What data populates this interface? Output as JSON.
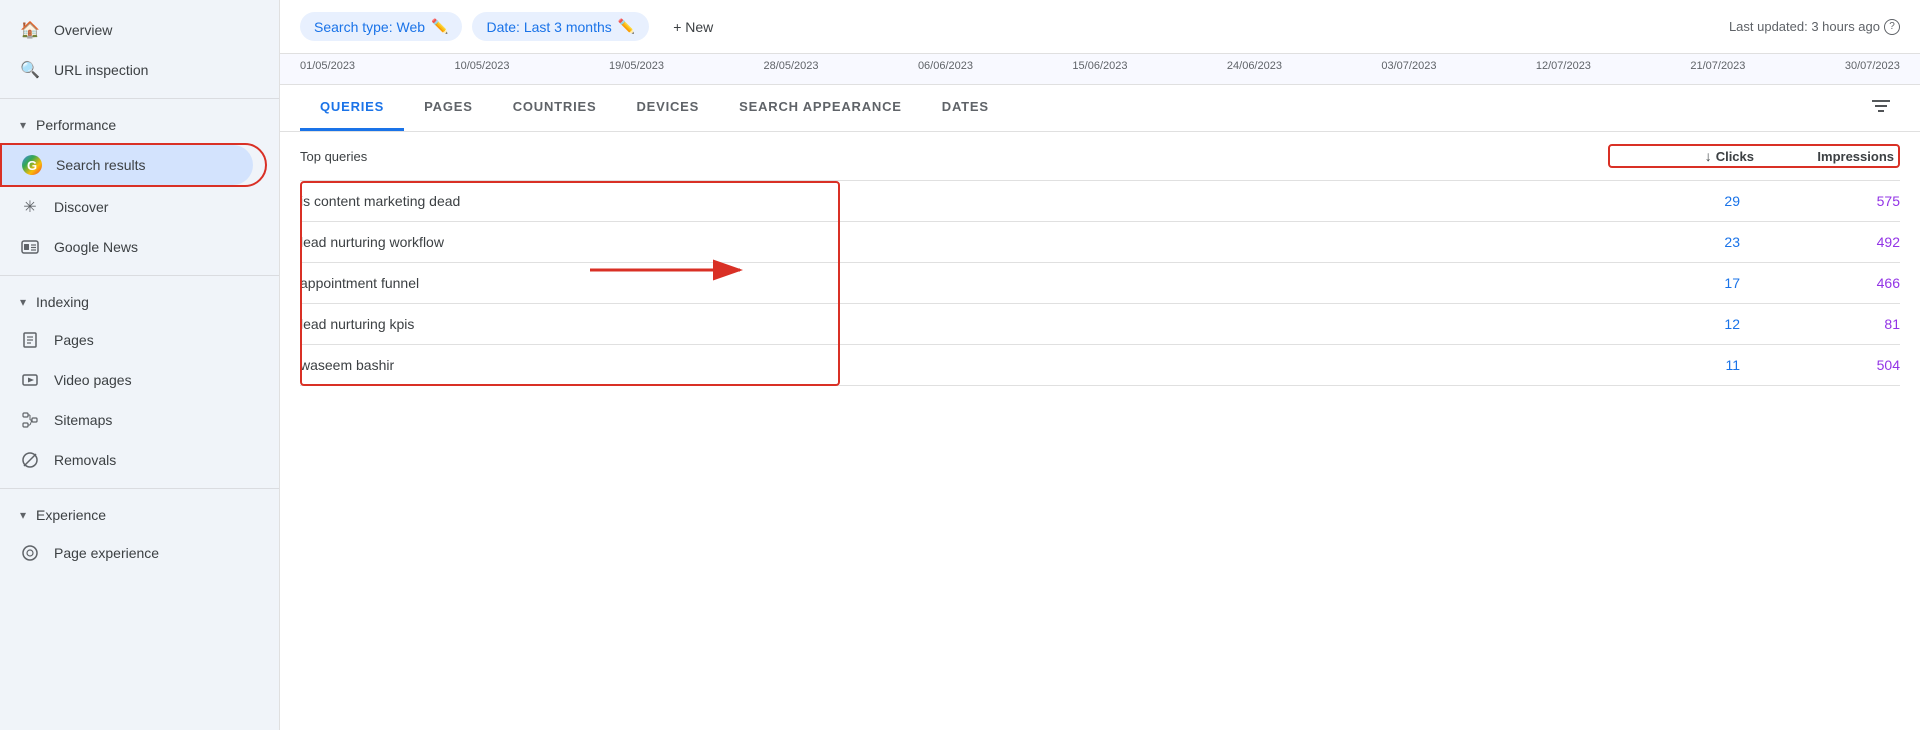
{
  "sidebar": {
    "overview_label": "Overview",
    "url_inspection_label": "URL inspection",
    "performance_label": "Performance",
    "search_results_label": "Search results",
    "discover_label": "Discover",
    "google_news_label": "Google News",
    "indexing_label": "Indexing",
    "pages_label": "Pages",
    "video_pages_label": "Video pages",
    "sitemaps_label": "Sitemaps",
    "removals_label": "Removals",
    "experience_label": "Experience",
    "page_experience_label": "Page experience"
  },
  "toolbar": {
    "search_type_label": "Search type: Web",
    "date_label": "Date: Last 3 months",
    "new_label": "+ New",
    "last_updated_label": "Last updated: 3 hours ago"
  },
  "timeline": {
    "dates": [
      "01/05/2023",
      "10/05/2023",
      "19/05/2023",
      "28/05/2023",
      "06/06/2023",
      "15/06/2023",
      "24/06/2023",
      "03/07/2023",
      "12/07/2023",
      "21/07/2023",
      "30/07/2023"
    ]
  },
  "tabs": {
    "items": [
      {
        "label": "QUERIES",
        "active": true
      },
      {
        "label": "PAGES",
        "active": false
      },
      {
        "label": "COUNTRIES",
        "active": false
      },
      {
        "label": "DEVICES",
        "active": false
      },
      {
        "label": "SEARCH APPEARANCE",
        "active": false
      },
      {
        "label": "DATES",
        "active": false
      }
    ]
  },
  "table": {
    "top_queries_label": "Top queries",
    "clicks_label": "Clicks",
    "impressions_label": "Impressions",
    "rows": [
      {
        "query": "is content marketing dead",
        "clicks": "29",
        "impressions": "575"
      },
      {
        "query": "lead nurturing workflow",
        "clicks": "23",
        "impressions": "492"
      },
      {
        "query": "appointment funnel",
        "clicks": "17",
        "impressions": "466"
      },
      {
        "query": "lead nurturing kpis",
        "clicks": "12",
        "impressions": "81"
      },
      {
        "query": "waseem bashir",
        "clicks": "11",
        "impressions": "504"
      }
    ]
  }
}
